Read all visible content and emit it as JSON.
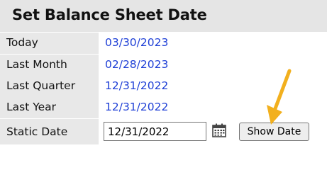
{
  "title": "Set Balance Sheet Date",
  "rows": [
    {
      "label": "Today",
      "date": "03/30/2023"
    },
    {
      "label": "Last Month",
      "date": "02/28/2023"
    },
    {
      "label": "Last Quarter",
      "date": "12/31/2022"
    },
    {
      "label": "Last Year",
      "date": "12/31/2022"
    }
  ],
  "static_date": {
    "label": "Static Date",
    "value": "12/31/2022",
    "button_label": "Show Date"
  },
  "icons": {
    "calendar": "calendar-icon",
    "annotation": "arrow-icon"
  },
  "colors": {
    "header_bg": "#e5e5e5",
    "label_bg": "#e8e8e8",
    "link": "#1e3fd6",
    "annotation_arrow": "#f2b01e"
  }
}
